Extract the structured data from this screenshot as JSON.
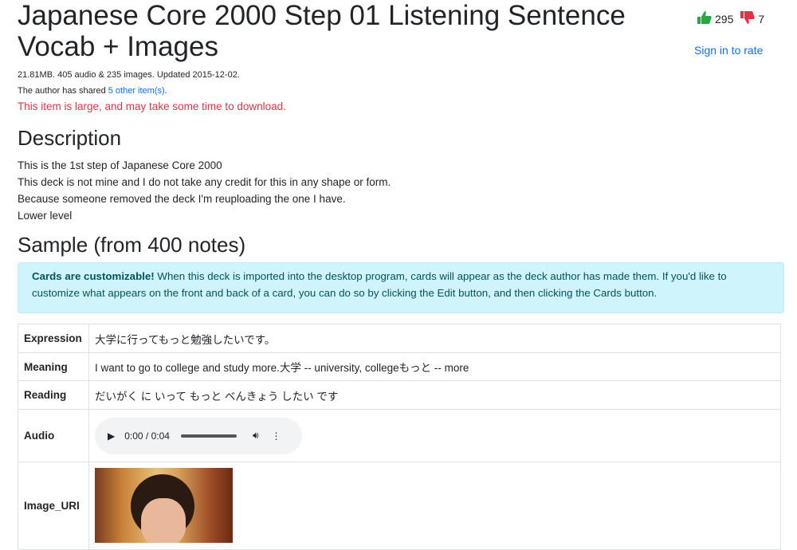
{
  "header": {
    "title": "Japanese Core 2000 Step 01 Listening Sentence Vocab + Images",
    "upvotes": "295",
    "downvotes": "7",
    "sign_in": "Sign in to rate"
  },
  "meta": {
    "info": "21.81MB. 405 audio & 235 images. Updated 2015-12-02.",
    "shared_prefix": "The author has shared ",
    "shared_link": "5 other item(s)",
    "shared_suffix": ".",
    "warning": "This item is large, and may take some time to download."
  },
  "description": {
    "heading": "Description",
    "lines": [
      "This is the 1st step of Japanese Core 2000",
      "This deck is not mine and I do not take any credit for this in any shape or form.",
      "Because someone removed the deck I'm reuploading the one I have.",
      "Lower level"
    ]
  },
  "sample": {
    "heading": "Sample (from 400 notes)",
    "alert_bold": "Cards are customizable!",
    "alert_text": " When this deck is imported into the desktop program, cards will appear as the deck author has made them. If you'd like to customize what appears on the front and back of a card, you can do so by clicking the Edit button, and then clicking the Cards button.",
    "rows": [
      {
        "field": "Expression",
        "value": "大学に行ってもっと勉強したいです。"
      },
      {
        "field": "Meaning",
        "value": "I want to go to college and study more.大学 -- university, collegeもっと -- more"
      },
      {
        "field": "Reading",
        "value": "だいがく に いって もっと べんきょう したい です"
      },
      {
        "field": "Audio",
        "value": "0:00 / 0:04"
      },
      {
        "field": "Image_URI",
        "value": ""
      }
    ]
  },
  "colors": {
    "accent": "#0d6efd",
    "warning": "#dc3545",
    "alert_bg": "#cff4fc",
    "thumb_up": "#28a745",
    "thumb_down": "#dc3545"
  }
}
